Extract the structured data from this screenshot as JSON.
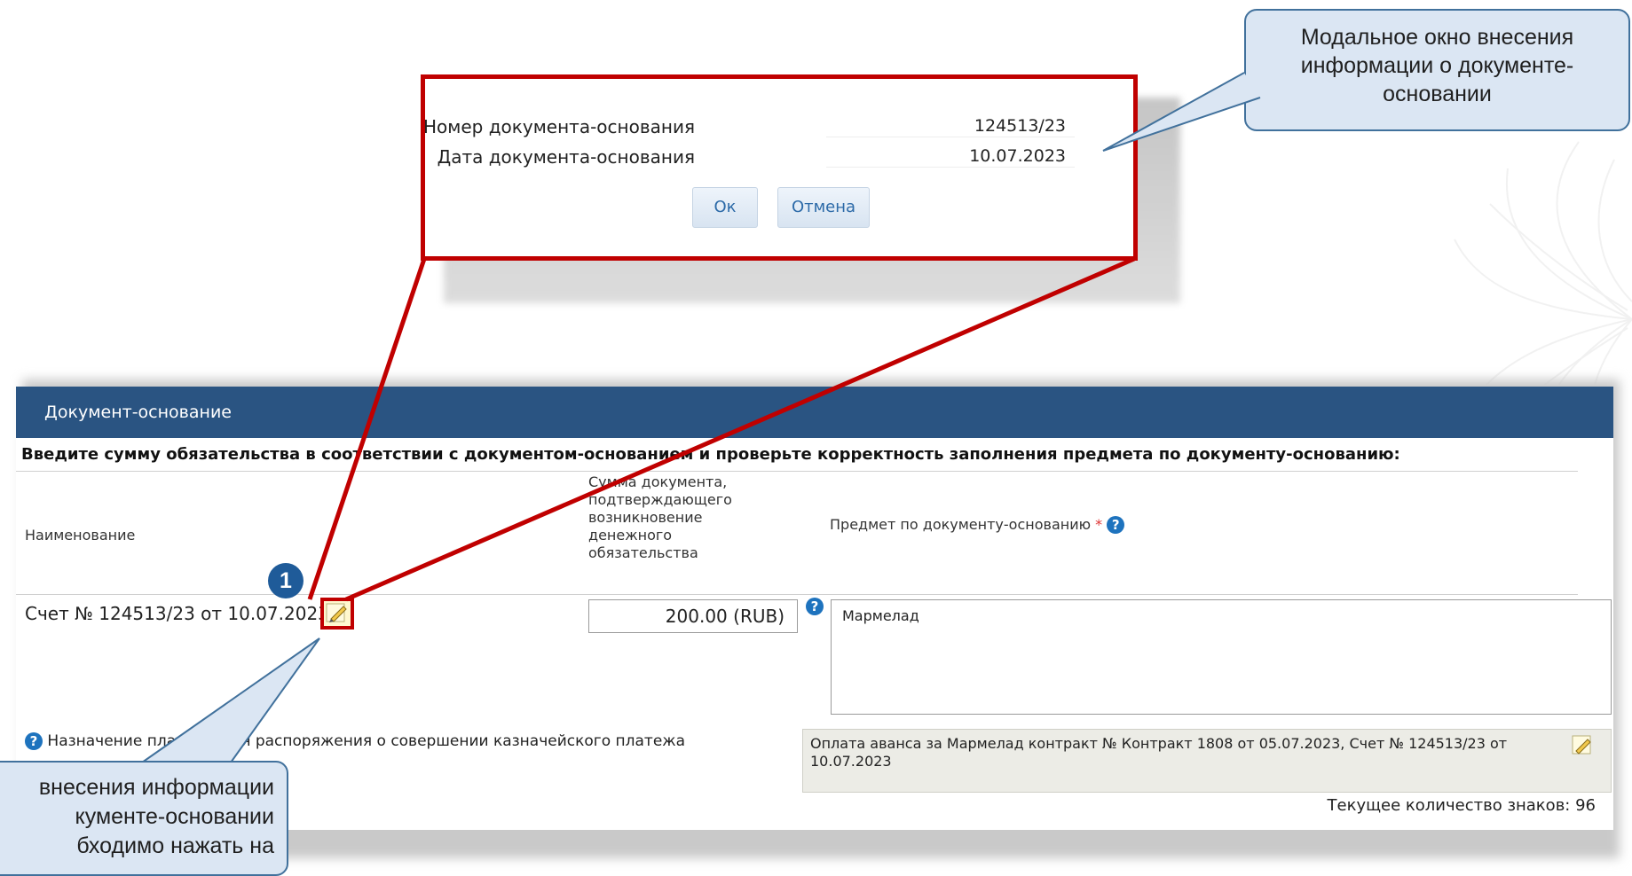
{
  "callouts": {
    "top": "Модальное окно внесения информации о документе-основании",
    "bottom_lines": [
      "внесения информации",
      "кументе-основании",
      "бходимо нажать на"
    ],
    "badge": "1"
  },
  "modal": {
    "doc_number_label": "Номер документа-основания",
    "doc_number_value": "124513/23",
    "doc_date_label": "Дата документа-основания",
    "doc_date_value": "10.07.2023",
    "ok_label": "Ок",
    "cancel_label": "Отмена"
  },
  "panel": {
    "title": "Документ-основание",
    "instruction": "Введите сумму обязательства в соответствии с документом-основанием и проверьте корректность заполнения предмета по документу-основанию:",
    "columns": {
      "name": "Наименование",
      "amount_lines": [
        "Сумма документа,",
        "подтверждающего",
        "возникновение",
        "денежного",
        "обязательства"
      ],
      "subject": "Предмет по документу-основанию",
      "required_mark": "*"
    },
    "row": {
      "name": "Счет № 124513/23 от 10.07.2023",
      "amount": "200.00 (RUB)",
      "subject": "Мармелад"
    },
    "purpose_label": "Назначение платежа для распоряжения о совершении казначейского платежа",
    "purpose_value": "Оплата аванса за Мармелад контракт № Контракт 1808 от 05.07.2023, Счет № 124513/23 от 10.07.2023",
    "char_count": "Текущее количество знаков: 96"
  },
  "icons": {
    "help": "help-icon",
    "edit": "pencil-edit-icon"
  },
  "colors": {
    "header_bg": "#2a5482",
    "highlight": "#c00000",
    "callout_bg": "#dbe6f3",
    "callout_border": "#41719c"
  }
}
